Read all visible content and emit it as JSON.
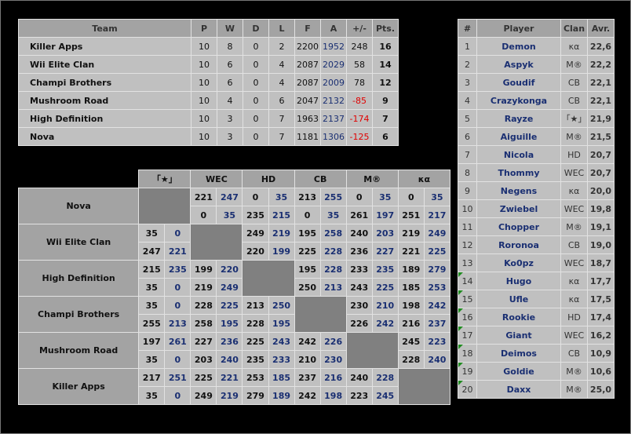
{
  "standings": {
    "headers": [
      "Team",
      "P",
      "W",
      "D",
      "L",
      "F",
      "A",
      "+/-",
      "Pts."
    ],
    "rows": [
      {
        "team": "Killer Apps",
        "p": "10",
        "w": "8",
        "d": "0",
        "l": "2",
        "f": "2200",
        "a": "1952",
        "diff": "248",
        "pts": "16"
      },
      {
        "team": "Wii Elite Clan",
        "p": "10",
        "w": "6",
        "d": "0",
        "l": "4",
        "f": "2087",
        "a": "2029",
        "diff": "58",
        "pts": "14"
      },
      {
        "team": "Champi Brothers",
        "p": "10",
        "w": "6",
        "d": "0",
        "l": "4",
        "f": "2087",
        "a": "2009",
        "diff": "78",
        "pts": "12"
      },
      {
        "team": "Mushroom Road",
        "p": "10",
        "w": "4",
        "d": "0",
        "l": "6",
        "f": "2047",
        "a": "2132",
        "diff": "-85",
        "pts": "9"
      },
      {
        "team": "High Definition",
        "p": "10",
        "w": "3",
        "d": "0",
        "l": "7",
        "f": "1963",
        "a": "2137",
        "diff": "-174",
        "pts": "7"
      },
      {
        "team": "Nova",
        "p": "10",
        "w": "3",
        "d": "0",
        "l": "7",
        "f": "1181",
        "a": "1306",
        "diff": "-125",
        "pts": "6"
      }
    ]
  },
  "cross": {
    "columns": [
      "「★」",
      "WEC",
      "HD",
      "CB",
      "M®",
      "κα"
    ],
    "rows": [
      {
        "team": "Nova",
        "cells": [
          null,
          [
            [
              "221",
              "247"
            ],
            [
              "0",
              "35"
            ]
          ],
          [
            [
              "0",
              "35"
            ],
            [
              "235",
              "215"
            ]
          ],
          [
            [
              "213",
              "255"
            ],
            [
              "0",
              "35"
            ]
          ],
          [
            [
              "0",
              "35"
            ],
            [
              "261",
              "197"
            ]
          ],
          [
            [
              "0",
              "35"
            ],
            [
              "251",
              "217"
            ]
          ]
        ]
      },
      {
        "team": "Wii Elite Clan",
        "cells": [
          [
            [
              "35",
              "0"
            ],
            [
              "247",
              "221"
            ]
          ],
          null,
          [
            [
              "249",
              "219"
            ],
            [
              "220",
              "199"
            ]
          ],
          [
            [
              "195",
              "258"
            ],
            [
              "225",
              "228"
            ]
          ],
          [
            [
              "240",
              "203"
            ],
            [
              "236",
              "227"
            ]
          ],
          [
            [
              "219",
              "249"
            ],
            [
              "221",
              "225"
            ]
          ]
        ]
      },
      {
        "team": "High Definition",
        "cells": [
          [
            [
              "215",
              "235"
            ],
            [
              "35",
              "0"
            ]
          ],
          [
            [
              "199",
              "220"
            ],
            [
              "219",
              "249"
            ]
          ],
          null,
          [
            [
              "195",
              "228"
            ],
            [
              "250",
              "213"
            ]
          ],
          [
            [
              "233",
              "235"
            ],
            [
              "243",
              "225"
            ]
          ],
          [
            [
              "189",
              "279"
            ],
            [
              "185",
              "253"
            ]
          ]
        ]
      },
      {
        "team": "Champi Brothers",
        "cells": [
          [
            [
              "35",
              "0"
            ],
            [
              "255",
              "213"
            ]
          ],
          [
            [
              "228",
              "225"
            ],
            [
              "258",
              "195"
            ]
          ],
          [
            [
              "213",
              "250"
            ],
            [
              "228",
              "195"
            ]
          ],
          null,
          [
            [
              "230",
              "210"
            ],
            [
              "226",
              "242"
            ]
          ],
          [
            [
              "198",
              "242"
            ],
            [
              "216",
              "237"
            ]
          ]
        ]
      },
      {
        "team": "Mushroom Road",
        "cells": [
          [
            [
              "197",
              "261"
            ],
            [
              "35",
              "0"
            ]
          ],
          [
            [
              "227",
              "236"
            ],
            [
              "203",
              "240"
            ]
          ],
          [
            [
              "225",
              "243"
            ],
            [
              "235",
              "233"
            ]
          ],
          [
            [
              "242",
              "226"
            ],
            [
              "210",
              "230"
            ]
          ],
          null,
          [
            [
              "245",
              "223"
            ],
            [
              "228",
              "240"
            ]
          ]
        ]
      },
      {
        "team": "Killer Apps",
        "cells": [
          [
            [
              "217",
              "251"
            ],
            [
              "35",
              "0"
            ]
          ],
          [
            [
              "225",
              "221"
            ],
            [
              "249",
              "219"
            ]
          ],
          [
            [
              "253",
              "185"
            ],
            [
              "279",
              "189"
            ]
          ],
          [
            [
              "237",
              "216"
            ],
            [
              "242",
              "198"
            ]
          ],
          [
            [
              "240",
              "228"
            ],
            [
              "223",
              "245"
            ]
          ],
          null
        ]
      }
    ]
  },
  "players": {
    "headers": [
      "#",
      "Player",
      "Clan",
      "Avr."
    ],
    "rows": [
      {
        "rank": "1",
        "name": "Demon",
        "clan": "κα",
        "avr": "22,6",
        "flag": false
      },
      {
        "rank": "2",
        "name": "Aspyk",
        "clan": "M®",
        "avr": "22,2",
        "flag": false
      },
      {
        "rank": "3",
        "name": "Goudif",
        "clan": "CB",
        "avr": "22,1",
        "flag": false
      },
      {
        "rank": "4",
        "name": "Crazykonga",
        "clan": "CB",
        "avr": "22,1",
        "flag": false
      },
      {
        "rank": "5",
        "name": "Rayze",
        "clan": "「★」",
        "avr": "21,9",
        "flag": false
      },
      {
        "rank": "6",
        "name": "Aiguille",
        "clan": "M®",
        "avr": "21,5",
        "flag": false
      },
      {
        "rank": "7",
        "name": "Nicola",
        "clan": "HD",
        "avr": "20,7",
        "flag": false
      },
      {
        "rank": "8",
        "name": "Thommy",
        "clan": "WEC",
        "avr": "20,7",
        "flag": false
      },
      {
        "rank": "9",
        "name": "Negens",
        "clan": "κα",
        "avr": "20,0",
        "flag": false
      },
      {
        "rank": "10",
        "name": "Zwiebel",
        "clan": "WEC",
        "avr": "19,8",
        "flag": false
      },
      {
        "rank": "11",
        "name": "Chopper",
        "clan": "M®",
        "avr": "19,1",
        "flag": false
      },
      {
        "rank": "12",
        "name": "Roronoa",
        "clan": "CB",
        "avr": "19,0",
        "flag": false
      },
      {
        "rank": "13",
        "name": "Ko0pz",
        "clan": "WEC",
        "avr": "18,7",
        "flag": false
      },
      {
        "rank": "14",
        "name": "Hugo",
        "clan": "κα",
        "avr": "17,7",
        "flag": true
      },
      {
        "rank": "15",
        "name": "Ufle",
        "clan": "κα",
        "avr": "17,5",
        "flag": true
      },
      {
        "rank": "16",
        "name": "Rookie",
        "clan": "HD",
        "avr": "17,4",
        "flag": true
      },
      {
        "rank": "17",
        "name": "Giant",
        "clan": "WEC",
        "avr": "16,2",
        "flag": true
      },
      {
        "rank": "18",
        "name": "Deimos",
        "clan": "CB",
        "avr": "10,9",
        "flag": true
      },
      {
        "rank": "19",
        "name": "Goldie",
        "clan": "M®",
        "avr": "10,6",
        "flag": true
      },
      {
        "rank": "20",
        "name": "Daxx",
        "clan": "M®",
        "avr": "25,0",
        "flag": true
      }
    ]
  },
  "colors": {
    "score_blue": "#1a2f72",
    "negative_red": "#e00000",
    "comment_flag_green": "#1f8a1f"
  }
}
